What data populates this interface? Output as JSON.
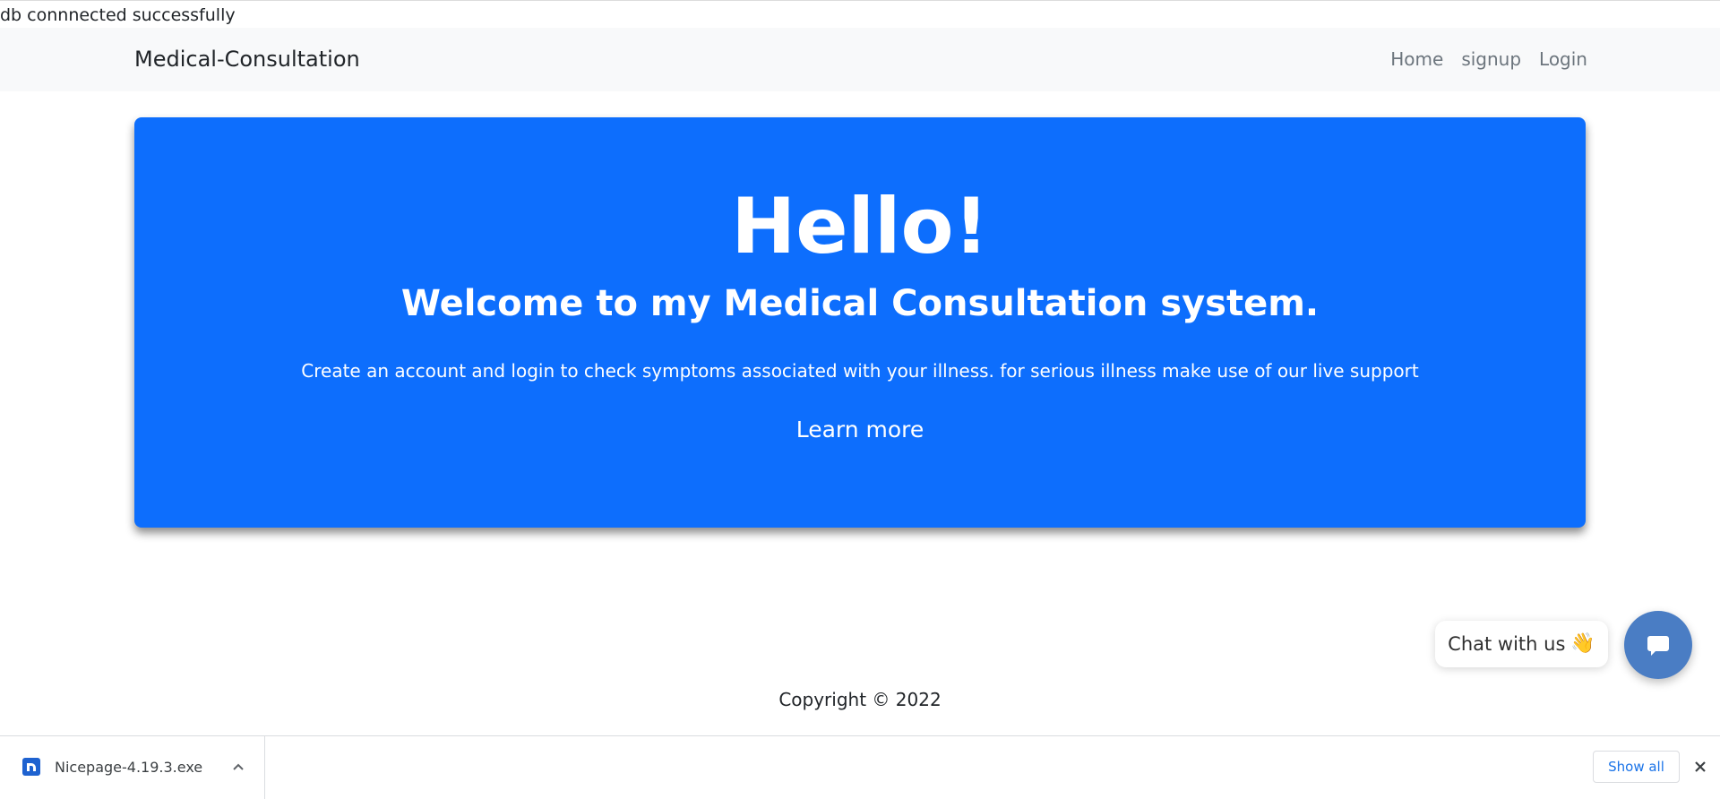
{
  "status": {
    "db_message": "db connnected successfully"
  },
  "navbar": {
    "brand": "Medical-Consultation",
    "links": [
      "Home",
      "signup",
      "Login"
    ]
  },
  "hero": {
    "title": "Hello!",
    "subtitle": "Welcome to my Medical Consultation system.",
    "text": "Create an account and login to check symptoms associated with your illness. for serious illness make use of our live support",
    "button_label": "Learn more",
    "background_color": "#0d6efd"
  },
  "chat_widget": {
    "label": "Chat with us",
    "emoji": "👋",
    "button_icon": "chat-bubble-icon",
    "button_color": "#4a7dc4"
  },
  "footer": {
    "copyright": "Copyright © 2022"
  },
  "download_bar": {
    "file_name": "Nicepage-4.19.3.exe",
    "file_icon": "nicepage-app-icon",
    "show_all_label": "Show all",
    "close_icon": "close-icon"
  }
}
